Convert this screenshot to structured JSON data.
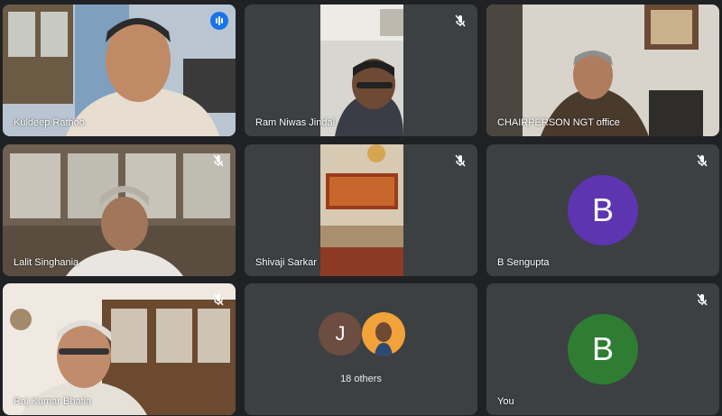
{
  "participants": [
    {
      "name": "Kuldeep Rathoo",
      "speaking": true
    },
    {
      "name": "Ram Niwas Jindal",
      "muted": true
    },
    {
      "name": "CHAIRPERSON NGT office"
    },
    {
      "name": "Lalit Singhania",
      "muted": true
    },
    {
      "name": "Shivaji Sarkar",
      "muted": true
    },
    {
      "name": "B Sengupta",
      "initial": "B",
      "avatar_color": "#5e35b1",
      "muted": true
    },
    {
      "name": "Raj Kumar Bhatia",
      "muted": true
    },
    {
      "others_label": "18 others",
      "initial": "J",
      "avatar_color": "#6d4c41"
    },
    {
      "name": "You",
      "initial": "B",
      "avatar_color": "#2e7d32",
      "muted": true
    }
  ],
  "colors": {
    "tile": "#3c4043",
    "background": "#202124",
    "active_outline": "#8ab4f8",
    "speaking": "#1a73e8"
  }
}
